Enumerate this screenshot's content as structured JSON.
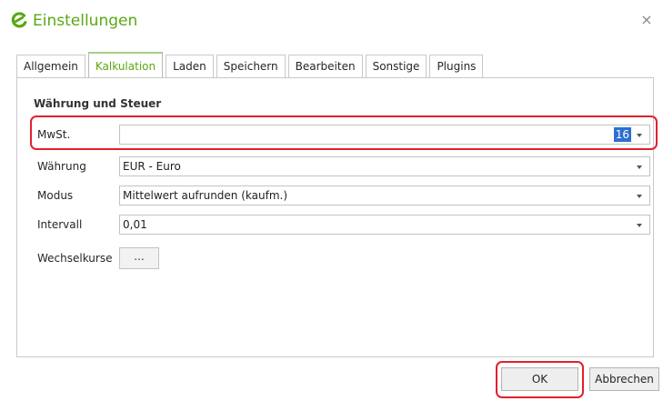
{
  "window": {
    "title": "Einstellungen",
    "close_glyph": "×"
  },
  "tabs": [
    {
      "label": "Allgemein",
      "active": false
    },
    {
      "label": "Kalkulation",
      "active": true
    },
    {
      "label": "Laden",
      "active": false
    },
    {
      "label": "Speichern",
      "active": false
    },
    {
      "label": "Bearbeiten",
      "active": false
    },
    {
      "label": "Sonstige",
      "active": false
    },
    {
      "label": "Plugins",
      "active": false
    }
  ],
  "section": {
    "title": "Währung und Steuer"
  },
  "fields": {
    "mwst": {
      "label": "MwSt.",
      "value": "16"
    },
    "waehrung": {
      "label": "Währung",
      "value": "EUR - Euro"
    },
    "modus": {
      "label": "Modus",
      "value": "Mittelwert aufrunden (kaufm.)"
    },
    "intervall": {
      "label": "Intervall",
      "value": "0,01"
    },
    "wechselkurse": {
      "label": "Wechselkurse",
      "button_label": "..."
    }
  },
  "buttons": {
    "ok": "OK",
    "cancel": "Abbrechen"
  },
  "icons": {
    "app": "app-logo-icon",
    "close": "close-icon",
    "dropdown": "chevron-down-icon"
  },
  "colors": {
    "accent_green": "#5aa814",
    "highlight_red": "#e3202c",
    "selection_blue": "#2d6fd2"
  }
}
